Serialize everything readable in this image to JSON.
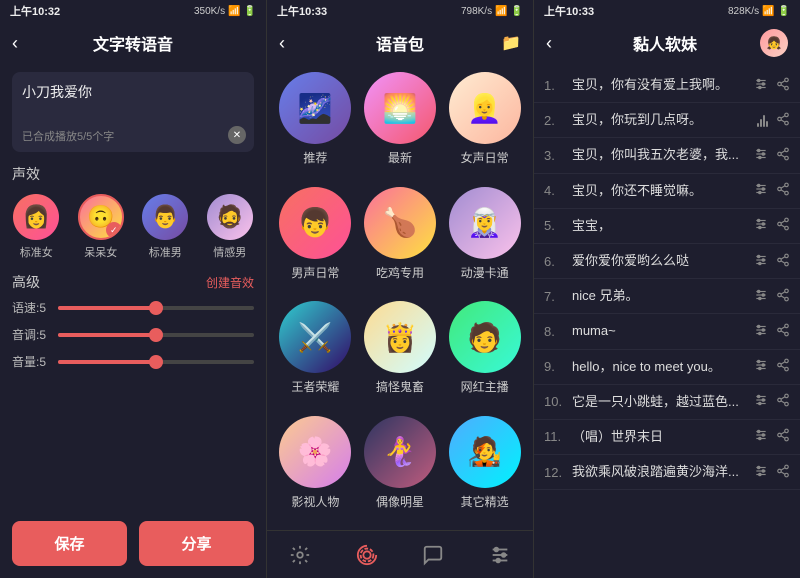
{
  "panels": {
    "left": {
      "status": {
        "time": "上午10:32",
        "speed": "350K/s"
      },
      "title": "文字转语音",
      "textarea": {
        "text": "小刀我爱你",
        "count": "已合成播放5/5个字"
      },
      "section_voice": "声效",
      "voices": [
        {
          "id": "v1",
          "name": "标准女",
          "emoji": "👩",
          "bg": "bg-red",
          "selected": false
        },
        {
          "id": "v2",
          "name": "呆呆女",
          "emoji": "🙃",
          "bg": "bg-orange",
          "selected": true
        },
        {
          "id": "v3",
          "name": "标准男",
          "emoji": "👨",
          "bg": "bg-blue",
          "selected": false
        },
        {
          "id": "v4",
          "name": "情感男",
          "emoji": "🧔",
          "bg": "bg-purple",
          "selected": false
        }
      ],
      "advanced": {
        "label": "高级",
        "create": "创建音效",
        "sliders": [
          {
            "label": "语速:5",
            "value": 50
          },
          {
            "label": "音调:5",
            "value": 50
          },
          {
            "label": "音量:5",
            "value": 50
          }
        ]
      },
      "save_btn": "保存",
      "share_btn": "分享"
    },
    "middle": {
      "status": {
        "time": "上午10:33",
        "speed": "798K/s"
      },
      "title": "语音包",
      "packs": [
        {
          "name": "推荐",
          "emoji": "🌌",
          "bg": "bg-blue"
        },
        {
          "name": "最新",
          "emoji": "🌅",
          "bg": "bg-sunset"
        },
        {
          "name": "女声日常",
          "emoji": "👱‍♀️",
          "bg": "bg-yellow"
        },
        {
          "name": "男声日常",
          "emoji": "👦",
          "bg": "bg-red"
        },
        {
          "name": "吃鸡专用",
          "emoji": "🍗",
          "bg": "bg-orange"
        },
        {
          "name": "动漫卡通",
          "emoji": "🧝‍♀️",
          "bg": "bg-purple"
        },
        {
          "name": "王者荣耀",
          "emoji": "⚔️",
          "bg": "bg-indigo"
        },
        {
          "name": "搞怪鬼畜",
          "emoji": "👸",
          "bg": "bg-pink"
        },
        {
          "name": "网红主播",
          "emoji": "🧑",
          "bg": "bg-teal"
        },
        {
          "name": "影视人物",
          "emoji": "🌸",
          "bg": "bg-light"
        },
        {
          "name": "偶像明星",
          "emoji": "🧜‍♀️",
          "bg": "bg-dark"
        },
        {
          "name": "其它精选",
          "emoji": "🧑‍🎤",
          "bg": "bg-green"
        }
      ],
      "nav": [
        {
          "id": "effects",
          "icon": "✨",
          "active": false
        },
        {
          "id": "packs",
          "icon": "🎵",
          "active": true
        },
        {
          "id": "chat",
          "icon": "💬",
          "active": false
        },
        {
          "id": "settings",
          "icon": "⚙️",
          "active": false
        }
      ]
    },
    "right": {
      "status": {
        "time": "上午10:33",
        "speed": "828K/s"
      },
      "title": "黏人软妹",
      "phrases": [
        {
          "num": "1.",
          "text": "宝贝，你有没有爱上我啊。"
        },
        {
          "num": "2.",
          "text": "宝贝，你玩到几点呀。"
        },
        {
          "num": "3.",
          "text": "宝贝，你叫我五次老婆，我..."
        },
        {
          "num": "4.",
          "text": "宝贝，你还不睡觉嘛。"
        },
        {
          "num": "5.",
          "text": "宝宝，"
        },
        {
          "num": "6.",
          "text": "爱你爱你爱哟么么哒"
        },
        {
          "num": "7.",
          "text": "nice 兄弟。"
        },
        {
          "num": "8.",
          "text": "muma~"
        },
        {
          "num": "9.",
          "text": "hello，nice to meet you。"
        },
        {
          "num": "10.",
          "text": "它是一只小跳蛙，越过蓝色..."
        },
        {
          "num": "11.",
          "text": "（唱）世界末日"
        },
        {
          "num": "12.",
          "text": "我欲乘风破浪踏遍黄沙海洋..."
        }
      ]
    }
  }
}
